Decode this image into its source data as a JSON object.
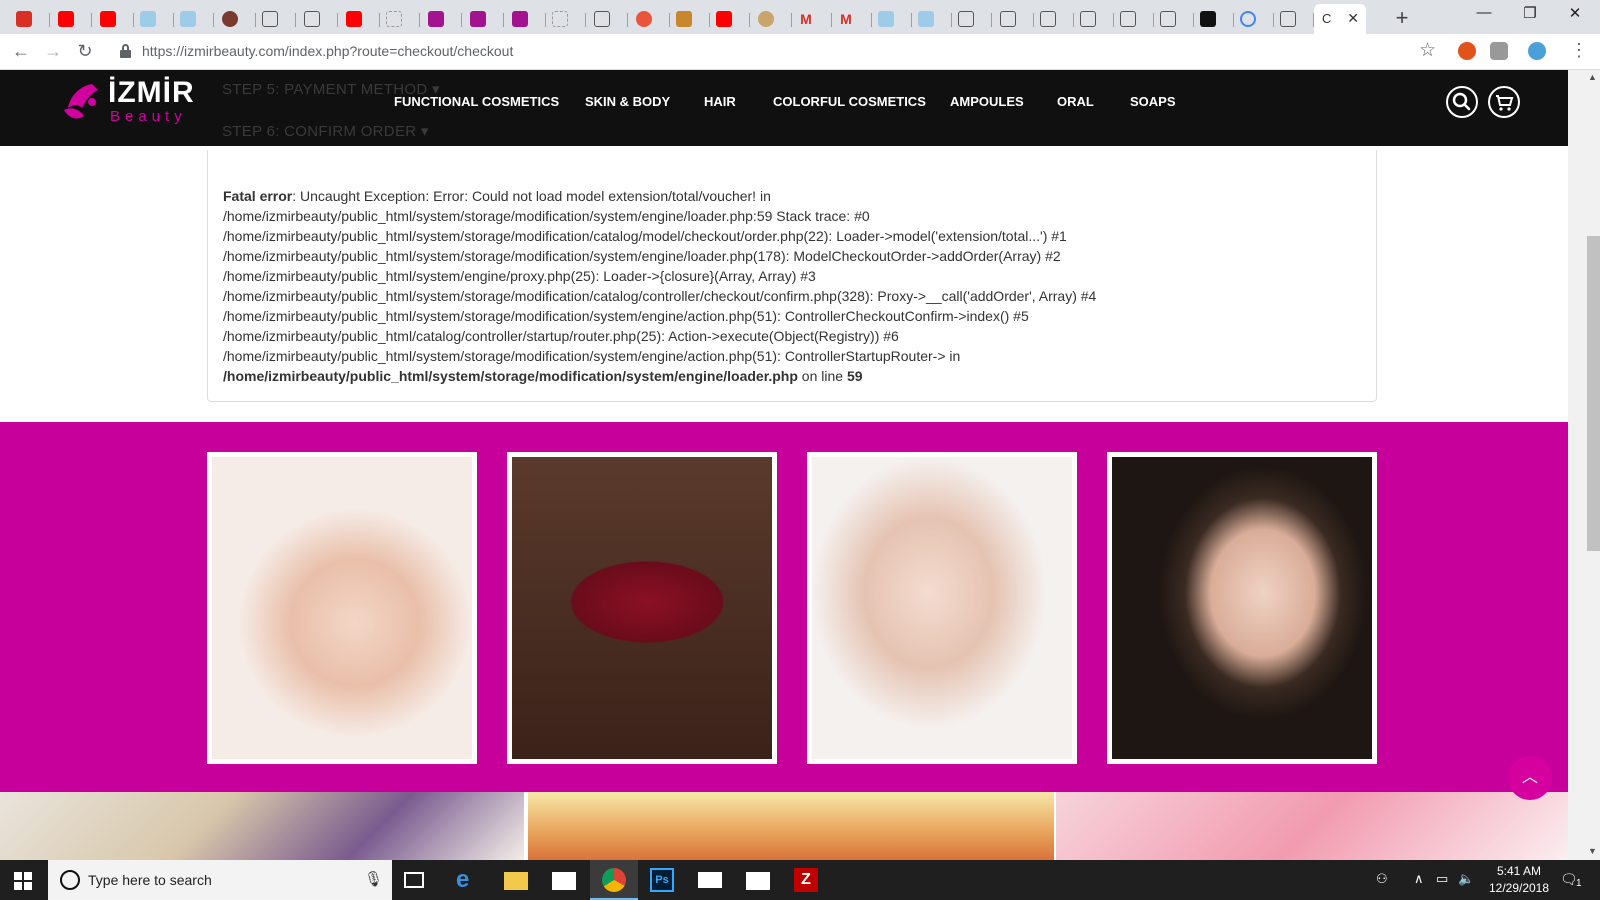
{
  "browser": {
    "active_tab_title": "C",
    "new_tab_label": "+",
    "window_controls": {
      "minimize": "—",
      "restore": "❐",
      "close": "✕"
    },
    "url": "https://izmirbeauty.com/index.php?route=checkout/checkout"
  },
  "site": {
    "logo_main": "İZMİR",
    "logo_sub": "Beauty",
    "checkout_steps": [
      "STEP 5: PAYMENT METHOD ▾",
      "STEP 6: CONFIRM ORDER ▾"
    ],
    "menu": [
      "FUNCTIONAL COSMETICS",
      "SKIN & BODY",
      "HAIR",
      "COLORFUL COSMETICS",
      "AMPOULES",
      "ORAL",
      "SOAPS"
    ]
  },
  "error": {
    "label": "Fatal error",
    "message": ": Uncaught Exception: Error: Could not load model extension/total/voucher! in",
    "lines": [
      "/home/izmirbeauty/public_html/system/storage/modification/system/engine/loader.php:59 Stack trace: #0",
      "/home/izmirbeauty/public_html/system/storage/modification/catalog/model/checkout/order.php(22): Loader->model('extension/total...') #1",
      "/home/izmirbeauty/public_html/system/storage/modification/system/engine/loader.php(178): ModelCheckoutOrder->addOrder(Array) #2",
      "/home/izmirbeauty/public_html/system/engine/proxy.php(25): Loader->{closure}(Array, Array) #3",
      "/home/izmirbeauty/public_html/system/storage/modification/catalog/controller/checkout/confirm.php(328): Proxy->__call('addOrder', Array) #4",
      "/home/izmirbeauty/public_html/system/storage/modification/system/engine/action.php(51): ControllerCheckoutConfirm->index() #5",
      "/home/izmirbeauty/public_html/catalog/controller/startup/router.php(25): Action->execute(Object(Registry)) #6",
      "/home/izmirbeauty/public_html/system/storage/modification/system/engine/action.php(51): ControllerStartupRouter-> in"
    ],
    "file": "/home/izmirbeauty/public_html/system/storage/modification/system/engine/loader.php",
    "on_line_label": " on line ",
    "line_number": "59"
  },
  "taskbar": {
    "search_placeholder": "Type here to search",
    "time": "5:41 AM",
    "date": "12/29/2018",
    "notification_count": "1"
  }
}
